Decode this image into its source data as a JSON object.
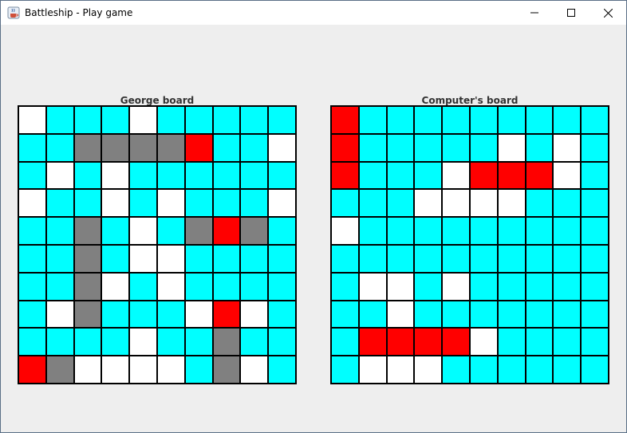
{
  "window": {
    "title": "Battleship - Play game",
    "icon": "java-cup-icon",
    "controls": [
      "minimize-icon",
      "maximize-icon",
      "close-icon"
    ]
  },
  "colors": {
    "water": "#00ffff",
    "miss": "#ffffff",
    "ship": "#808080",
    "hit": "#ff0000"
  },
  "player_board": {
    "label": "George board",
    "rows": [
      [
        "miss",
        "water",
        "water",
        "water",
        "miss",
        "water",
        "water",
        "water",
        "water",
        "water"
      ],
      [
        "water",
        "water",
        "ship",
        "ship",
        "ship",
        "ship",
        "hit",
        "water",
        "water",
        "miss"
      ],
      [
        "water",
        "miss",
        "water",
        "miss",
        "water",
        "water",
        "water",
        "water",
        "water",
        "water"
      ],
      [
        "miss",
        "water",
        "water",
        "miss",
        "water",
        "miss",
        "water",
        "water",
        "water",
        "miss"
      ],
      [
        "water",
        "water",
        "ship",
        "water",
        "miss",
        "water",
        "ship",
        "hit",
        "ship",
        "water"
      ],
      [
        "water",
        "water",
        "ship",
        "water",
        "miss",
        "miss",
        "water",
        "water",
        "water",
        "water"
      ],
      [
        "water",
        "water",
        "ship",
        "miss",
        "water",
        "miss",
        "water",
        "water",
        "water",
        "water"
      ],
      [
        "water",
        "miss",
        "ship",
        "water",
        "water",
        "water",
        "miss",
        "hit",
        "miss",
        "water"
      ],
      [
        "water",
        "water",
        "water",
        "water",
        "miss",
        "water",
        "water",
        "ship",
        "water",
        "water"
      ],
      [
        "hit",
        "ship",
        "miss",
        "miss",
        "miss",
        "miss",
        "water",
        "ship",
        "miss",
        "water"
      ]
    ]
  },
  "computer_board": {
    "label": "Computer's board",
    "rows": [
      [
        "hit",
        "water",
        "water",
        "water",
        "water",
        "water",
        "water",
        "water",
        "water",
        "water"
      ],
      [
        "hit",
        "water",
        "water",
        "water",
        "water",
        "water",
        "miss",
        "water",
        "miss",
        "water"
      ],
      [
        "hit",
        "water",
        "water",
        "water",
        "miss",
        "hit",
        "hit",
        "hit",
        "miss",
        "water"
      ],
      [
        "water",
        "water",
        "water",
        "miss",
        "miss",
        "miss",
        "miss",
        "water",
        "water",
        "water"
      ],
      [
        "miss",
        "water",
        "water",
        "water",
        "water",
        "water",
        "water",
        "water",
        "water",
        "water"
      ],
      [
        "water",
        "water",
        "water",
        "water",
        "water",
        "water",
        "water",
        "water",
        "water",
        "water"
      ],
      [
        "water",
        "miss",
        "miss",
        "water",
        "miss",
        "water",
        "water",
        "water",
        "water",
        "water"
      ],
      [
        "water",
        "water",
        "miss",
        "water",
        "water",
        "water",
        "water",
        "water",
        "water",
        "water"
      ],
      [
        "water",
        "hit",
        "hit",
        "hit",
        "hit",
        "miss",
        "water",
        "water",
        "water",
        "water"
      ],
      [
        "water",
        "miss",
        "miss",
        "miss",
        "water",
        "water",
        "water",
        "water",
        "water",
        "water"
      ]
    ]
  }
}
